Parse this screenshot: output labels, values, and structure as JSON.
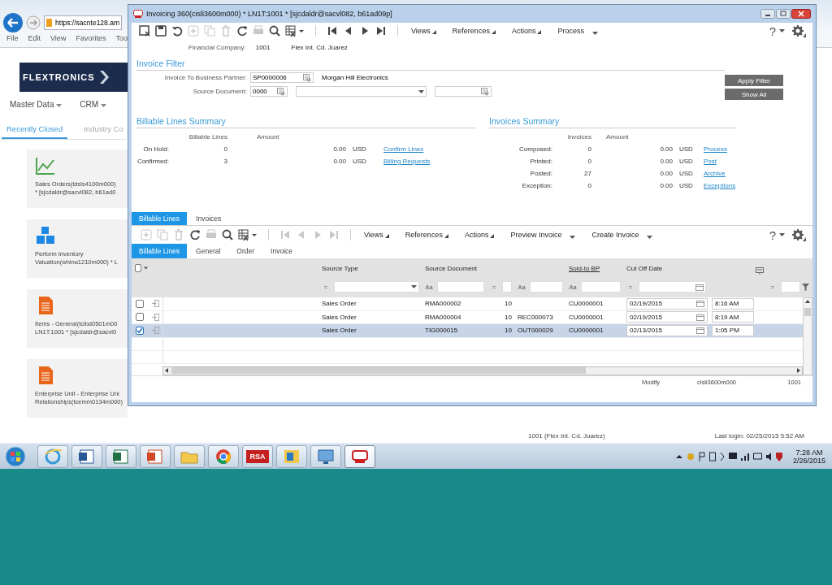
{
  "browser": {
    "address": "https://sacnte128.am",
    "menu": [
      "File",
      "Edit",
      "View",
      "Favorites",
      "Too"
    ],
    "logo": "FLEXTRONICS",
    "nav": [
      "Master Data",
      "CRM"
    ],
    "tabs": [
      {
        "label": "Recently Closed",
        "selected": true
      },
      {
        "label": "Industry Co",
        "selected": false
      }
    ],
    "tiles": [
      {
        "kind": "chart",
        "lines": [
          "Sales Orders(tdsls4100m000)",
          "* [sjcdaldr@sacvl082, b61ad0"
        ]
      },
      {
        "kind": "blocks",
        "lines": [
          "Perform Inventory",
          "Valuation(whina1210m000) * L"
        ]
      },
      {
        "kind": "document",
        "lines": [
          "Items - General(tcibd0501m00",
          "LN1T:1001 * [sjcdaldr@sacvl0"
        ]
      },
      {
        "kind": "document",
        "lines": [
          "Enterprise Unit - Enterprise Uni",
          "Relationships(tcemm0134m000)"
        ]
      }
    ],
    "status": [
      "1001 (Flex Int. Cd. Juarez)",
      "Last login: 02/25/2015 5:52 AM"
    ]
  },
  "window": {
    "title": "Invoicing 360(cisli3600m000) * LN1T:1001 * [sjcdaldr@sacvl082, b61ad09p]"
  },
  "toolbar": {
    "tools": [
      {
        "kind": "export",
        "disabled": false
      },
      {
        "kind": "save",
        "disabled": false
      },
      {
        "kind": "undo",
        "disabled": false
      },
      {
        "kind": "add",
        "disabled": true
      },
      {
        "kind": "copy",
        "disabled": true
      },
      {
        "kind": "delete",
        "disabled": true
      },
      {
        "kind": "refresh",
        "disabled": false
      },
      {
        "kind": "print",
        "disabled": true
      },
      {
        "kind": "search",
        "disabled": false
      },
      {
        "kind": "excel",
        "disabled": false
      },
      {
        "kind": "first",
        "disabled": false
      },
      {
        "kind": "prev",
        "disabled": false
      },
      {
        "kind": "next",
        "disabled": false
      },
      {
        "kind": "last",
        "disabled": false
      }
    ],
    "menus": [
      "Views",
      "References",
      "Actions",
      "Process"
    ],
    "help": "?"
  },
  "financial_company": {
    "label": "Financial Company:",
    "code": "1001",
    "name": "Flex Int. Cd. Juarez"
  },
  "filter": {
    "title": "Invoice Filter",
    "partner_label": "Invoice To Business Partner:",
    "partner": "SP0000006",
    "partner_name": "Morgan Hill Electronics",
    "source_label": "Source Document:",
    "source": "0000",
    "buttons": [
      "Apply Filter",
      "Show All"
    ]
  },
  "billable_summary": {
    "title": "Billable Lines Summary",
    "columns": [
      "Billable Lines",
      "Amount"
    ],
    "rows": [
      {
        "label": "On Hold:",
        "count": "0",
        "amount": "0.00",
        "currency": "USD",
        "link": "Confirm Lines"
      },
      {
        "label": "Confirmed:",
        "count": "3",
        "amount": "0.00",
        "currency": "USD",
        "link": "Billing Requests"
      }
    ]
  },
  "invoices_summary": {
    "title": "Invoices Summary",
    "columns": [
      "Invoices",
      "Amount"
    ],
    "rows": [
      {
        "label": "Composed:",
        "count": "0",
        "amount": "0.00",
        "currency": "USD",
        "link": "Process"
      },
      {
        "label": "Printed:",
        "count": "0",
        "amount": "0.00",
        "currency": "USD",
        "link": "Post"
      },
      {
        "label": "Posted:",
        "count": "27",
        "amount": "0.00",
        "currency": "USD",
        "link": "Archive"
      },
      {
        "label": "Exception:",
        "count": "0",
        "amount": "0.00",
        "currency": "USD",
        "link": "Exceptions"
      }
    ]
  },
  "tabs": [
    {
      "label": "Billable Lines",
      "selected": true
    },
    {
      "label": "Invoices",
      "selected": false
    }
  ],
  "grid_toolbar": {
    "tools": [
      {
        "kind": "add",
        "disabled": true
      },
      {
        "kind": "copy",
        "disabled": true
      },
      {
        "kind": "delete",
        "disabled": true
      },
      {
        "kind": "refresh",
        "disabled": false
      },
      {
        "kind": "print",
        "disabled": true
      },
      {
        "kind": "search",
        "disabled": false
      },
      {
        "kind": "excel",
        "disabled": false
      },
      {
        "kind": "first",
        "disabled": true
      },
      {
        "kind": "prev",
        "disabled": true
      },
      {
        "kind": "next",
        "disabled": true
      },
      {
        "kind": "last",
        "disabled": true
      }
    ],
    "menus": [
      {
        "label": "Views",
        "kind": "menu"
      },
      {
        "label": "References",
        "kind": "menu"
      },
      {
        "label": "Actions",
        "kind": "menu"
      },
      {
        "label": "Preview Invoice",
        "kind": "split"
      },
      {
        "label": "Create Invoice",
        "kind": "split"
      }
    ],
    "help": "?"
  },
  "subtabs": [
    {
      "label": "Billable Lines",
      "selected": true
    },
    {
      "label": "General",
      "selected": false
    },
    {
      "label": "Order",
      "selected": false
    },
    {
      "label": "Invoice",
      "selected": false
    }
  ],
  "table": {
    "columns": [
      "Source Type",
      "Source Document",
      "Sold-to BP",
      "Cut Off Date"
    ],
    "select_all_checked": false,
    "filter_operators": [
      "=",
      "Aa",
      "=",
      "Aa",
      "Aa",
      "=",
      "="
    ],
    "rows": [
      {
        "checked": false,
        "selected": false,
        "source_type": "Sales Order",
        "source_document": "RMA000002",
        "column_3": "10",
        "sold_to_bp": "CU0000001",
        "date": "02/19/2015",
        "time": "8:16 AM"
      },
      {
        "checked": false,
        "selected": false,
        "source_type": "Sales Order",
        "source_document": "RMA000004",
        "column_3": "10",
        "column_4": "REC000073",
        "sold_to_bp": "CU0000001",
        "date": "02/19/2015",
        "time": "8:19 AM"
      },
      {
        "checked": true,
        "selected": true,
        "source_type": "Sales Order",
        "source_document": "TIG000015",
        "column_3": "10",
        "column_4": "OUT000029",
        "sold_to_bp": "CU0000001",
        "date": "02/13/2015",
        "time": "1:05 PM"
      }
    ]
  },
  "status_bar": [
    "Modify",
    "cisli3600m000",
    "1001"
  ],
  "taskbar": {
    "apps": [
      {
        "kind": "ie",
        "selected": false
      },
      {
        "kind": "word",
        "selected": false
      },
      {
        "kind": "excel",
        "selected": false
      },
      {
        "kind": "powerpoint",
        "selected": false
      },
      {
        "kind": "folder",
        "selected": false
      },
      {
        "kind": "chrome",
        "selected": false
      },
      {
        "kind": "rsa",
        "label": "RSA",
        "selected": false
      },
      {
        "kind": "outlook",
        "selected": false
      },
      {
        "kind": "screen",
        "selected": false
      },
      {
        "kind": "erp",
        "selected": true
      }
    ],
    "time": "7:28 AM",
    "date": "2/26/2015"
  }
}
